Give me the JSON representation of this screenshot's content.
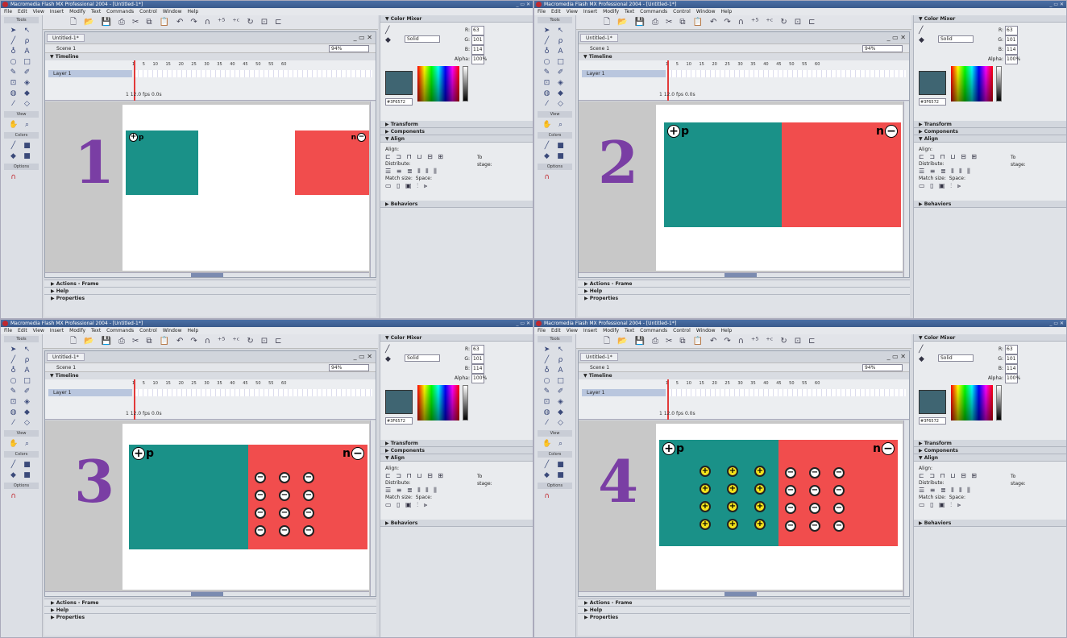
{
  "app": {
    "title": "Macromedia Flash MX Professional 2004 - [Untitled-1*]",
    "menu": [
      "File",
      "Edit",
      "View",
      "Insert",
      "Modify",
      "Text",
      "Commands",
      "Control",
      "Window",
      "Help"
    ],
    "tools_label": "Tools",
    "view_label": "View",
    "colors_label": "Colors",
    "options_label": "Options",
    "doc_tab": "Untitled-1*",
    "scene": "Scene 1",
    "zoom": "94%",
    "timeline_label": "Timeline",
    "layer_name": "Layer 1",
    "ruler": "1 5 10 15 20 25 30 35 40 45 50 55 60",
    "timeline_status": "1    12.0 fps    0.0s",
    "bottom_panels": [
      "Actions - Frame",
      "Help",
      "Properties"
    ]
  },
  "panels": {
    "color_mixer": "Color Mixer",
    "fill_type": "Solid",
    "r": "63",
    "g": "101",
    "b": "114",
    "r_label": "R:",
    "g_label": "G:",
    "b_label": "B:",
    "alpha_label": "Alpha:",
    "alpha": "100%",
    "hex": "#3F6572",
    "transform": "Transform",
    "components": "Components",
    "align": "Align",
    "align_text": "Align:",
    "distribute_text": "Distribute:",
    "match_size_text": "Match size:",
    "space_text": "Space:",
    "to_stage_text": "To stage:",
    "behaviors": "Behaviors"
  },
  "steps": [
    {
      "number": "1",
      "p_label": "p",
      "n_label": "n"
    },
    {
      "number": "2",
      "p_label": "p",
      "n_label": "n"
    },
    {
      "number": "3",
      "p_label": "p",
      "n_label": "n"
    },
    {
      "number": "4",
      "p_label": "p",
      "n_label": "n"
    }
  ],
  "colors": {
    "p_plate": "#1a9188",
    "n_plate": "#f14d4d",
    "hole": "#f6e31a",
    "step_number": "#7a3ea4",
    "fill_swatch": "#3f6572"
  },
  "symbols": {
    "plus": "+",
    "minus": "−"
  }
}
